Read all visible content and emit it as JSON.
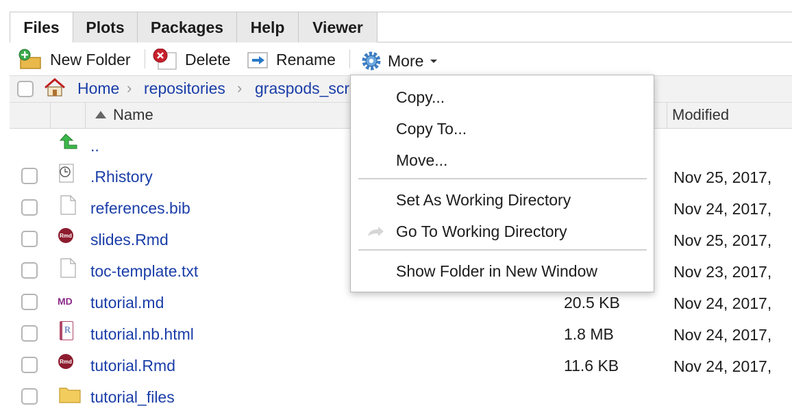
{
  "tabs": [
    {
      "label": "Files",
      "active": true
    },
    {
      "label": "Plots",
      "active": false
    },
    {
      "label": "Packages",
      "active": false
    },
    {
      "label": "Help",
      "active": false
    },
    {
      "label": "Viewer",
      "active": false
    }
  ],
  "toolbar": {
    "new_folder": "New Folder",
    "delete": "Delete",
    "rename": "Rename",
    "more": "More"
  },
  "breadcrumb": [
    "Home",
    "repositories",
    "graspods_scr"
  ],
  "columns": {
    "name": "Name",
    "modified": "Modified"
  },
  "files": [
    {
      "name": "..",
      "icon": "up-arrow-icon",
      "size": "",
      "modified": ""
    },
    {
      "name": ".Rhistory",
      "icon": "history-clock-icon",
      "size": "",
      "modified": "Nov 25, 2017,"
    },
    {
      "name": "references.bib",
      "icon": "blank-file-icon",
      "size": "",
      "modified": "Nov 24, 2017,"
    },
    {
      "name": "slides.Rmd",
      "icon": "rmd-file-icon",
      "size": "",
      "modified": "Nov 25, 2017,"
    },
    {
      "name": "toc-template.txt",
      "icon": "blank-file-icon",
      "size": "",
      "modified": "Nov 23, 2017,"
    },
    {
      "name": "tutorial.md",
      "icon": "md-file-icon",
      "size": "20.5 KB",
      "modified": "Nov 24, 2017,"
    },
    {
      "name": "tutorial.nb.html",
      "icon": "r-notebook-icon",
      "size": "1.8 MB",
      "modified": "Nov 24, 2017,"
    },
    {
      "name": "tutorial.Rmd",
      "icon": "rmd-file-icon",
      "size": "11.6 KB",
      "modified": "Nov 24, 2017,"
    },
    {
      "name": "tutorial_files",
      "icon": "folder-icon",
      "size": "",
      "modified": ""
    }
  ],
  "menu": {
    "copy": "Copy...",
    "copy_to": "Copy To...",
    "move": "Move...",
    "set_wd": "Set As Working Directory",
    "goto_wd": "Go To Working Directory",
    "show_folder": "Show Folder in New Window"
  },
  "icon_labels": {
    "rmd": "Rmd",
    "md": "MD",
    "r": "R"
  },
  "colors": {
    "link": "#1a3ea8",
    "tab_inactive": "#e9e9e9",
    "header_bg": "#f2f2f2"
  }
}
